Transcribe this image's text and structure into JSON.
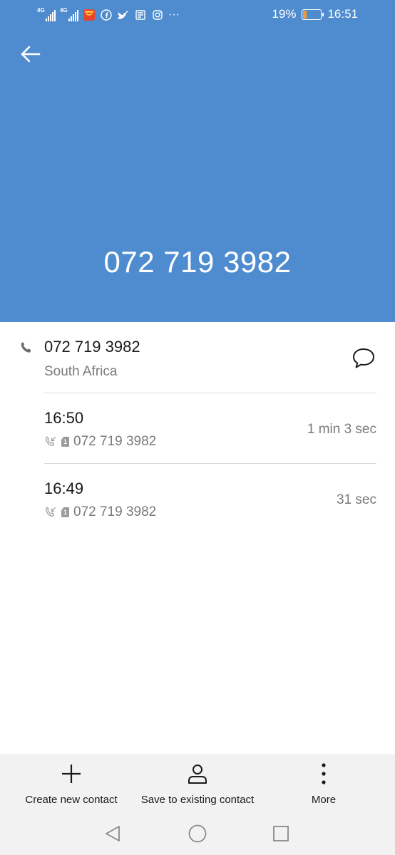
{
  "status_bar": {
    "network_1": "4G",
    "network_2": "4G",
    "battery_percent": "19%",
    "battery_level": 0.19,
    "time": "16:51",
    "more_indicator": "···",
    "app_icons": [
      "aliexpress-icon",
      "facebook-icon",
      "twitter-icon",
      "news-icon",
      "instagram-icon"
    ]
  },
  "header": {
    "phone_number": "072 719 3982",
    "background_color": "#4f8ccf"
  },
  "contact": {
    "number": "072 719 3982",
    "region": "South Africa"
  },
  "calls": [
    {
      "time": "16:50",
      "number": "072 719 3982",
      "sim": "1",
      "duration": "1 min 3 sec"
    },
    {
      "time": "16:49",
      "number": "072 719 3982",
      "sim": "1",
      "duration": "31 sec"
    }
  ],
  "actions": {
    "create_label": "Create new contact",
    "save_label": "Save to existing contact",
    "more_label": "More"
  }
}
